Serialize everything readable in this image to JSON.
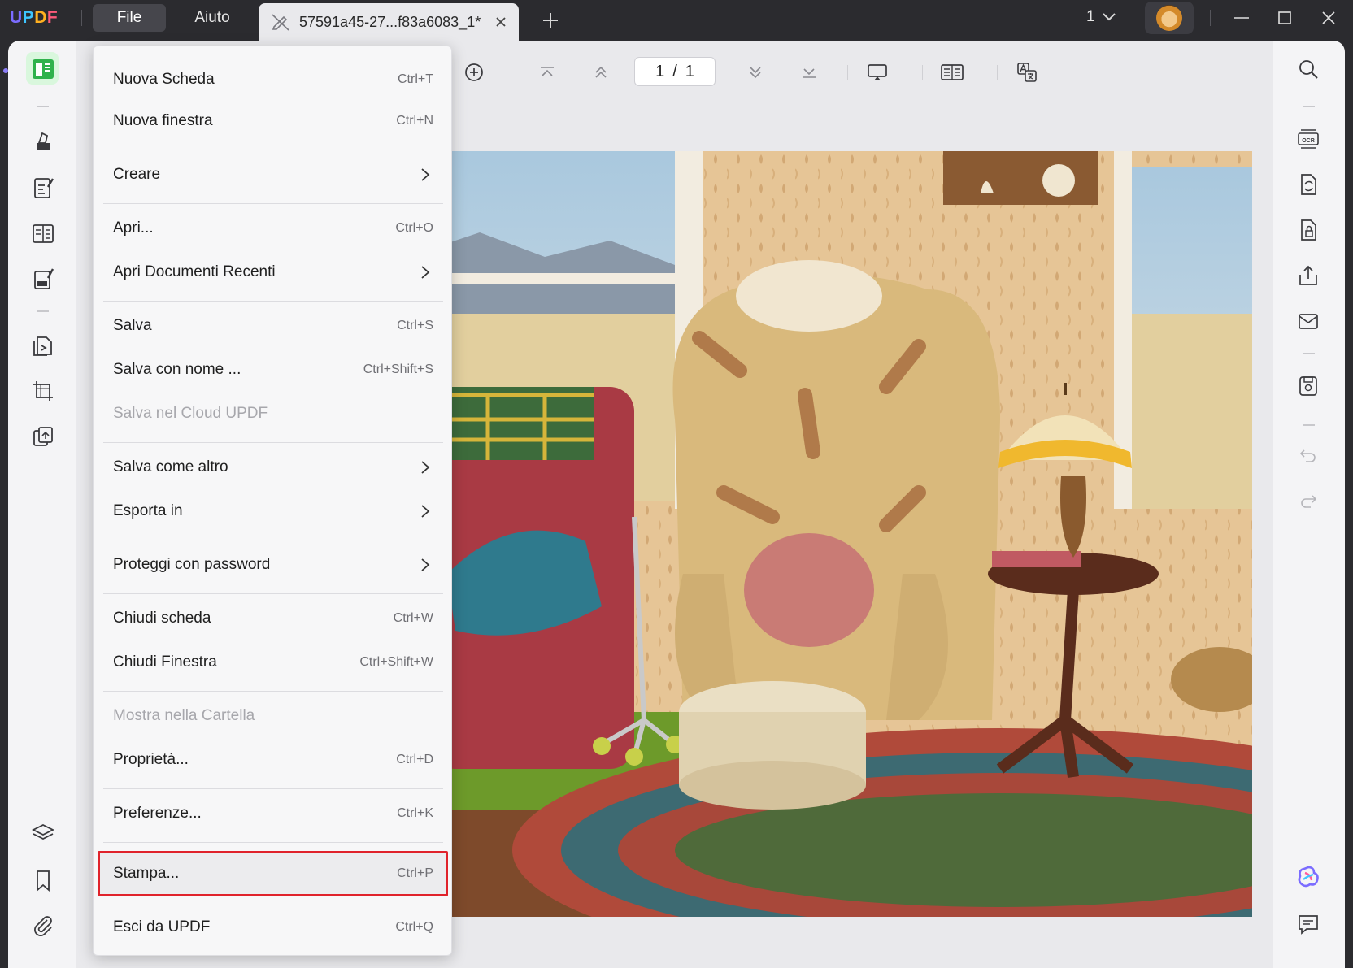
{
  "app": {
    "logo": "UPDF"
  },
  "menubar": {
    "file": "File",
    "help": "Aiuto"
  },
  "tab": {
    "title": "57591a45-27...f83a6083_1*"
  },
  "titlebar": {
    "tab_count": "1"
  },
  "toolbar": {
    "page_current": "1",
    "page_sep": "/",
    "page_total": "1"
  },
  "file_menu": {
    "items": [
      {
        "label": "Nuova Scheda",
        "shortcut": "Ctrl+T"
      },
      {
        "label": "Nuova finestra",
        "shortcut": "Ctrl+N"
      },
      {
        "label": "Creare",
        "shortcut": ""
      },
      {
        "label": "Apri...",
        "shortcut": "Ctrl+O"
      },
      {
        "label": "Apri Documenti Recenti",
        "shortcut": ""
      },
      {
        "label": "Salva",
        "shortcut": "Ctrl+S"
      },
      {
        "label": "Salva con nome ...",
        "shortcut": "Ctrl+Shift+S"
      },
      {
        "label": "Salva nel Cloud UPDF",
        "shortcut": ""
      },
      {
        "label": "Salva come altro",
        "shortcut": ""
      },
      {
        "label": "Esporta in",
        "shortcut": ""
      },
      {
        "label": "Proteggi con password",
        "shortcut": ""
      },
      {
        "label": "Chiudi scheda",
        "shortcut": "Ctrl+W"
      },
      {
        "label": "Chiudi Finestra",
        "shortcut": "Ctrl+Shift+W"
      },
      {
        "label": "Mostra nella Cartella",
        "shortcut": ""
      },
      {
        "label": "Proprietà...",
        "shortcut": "Ctrl+D"
      },
      {
        "label": "Preferenze...",
        "shortcut": "Ctrl+K"
      },
      {
        "label": "Stampa...",
        "shortcut": "Ctrl+P"
      },
      {
        "label": "Esci da UPDF",
        "shortcut": "Ctrl+Q"
      }
    ]
  },
  "colors": {
    "highlight": "#e0232b",
    "accent_green": "#2fb24c"
  }
}
